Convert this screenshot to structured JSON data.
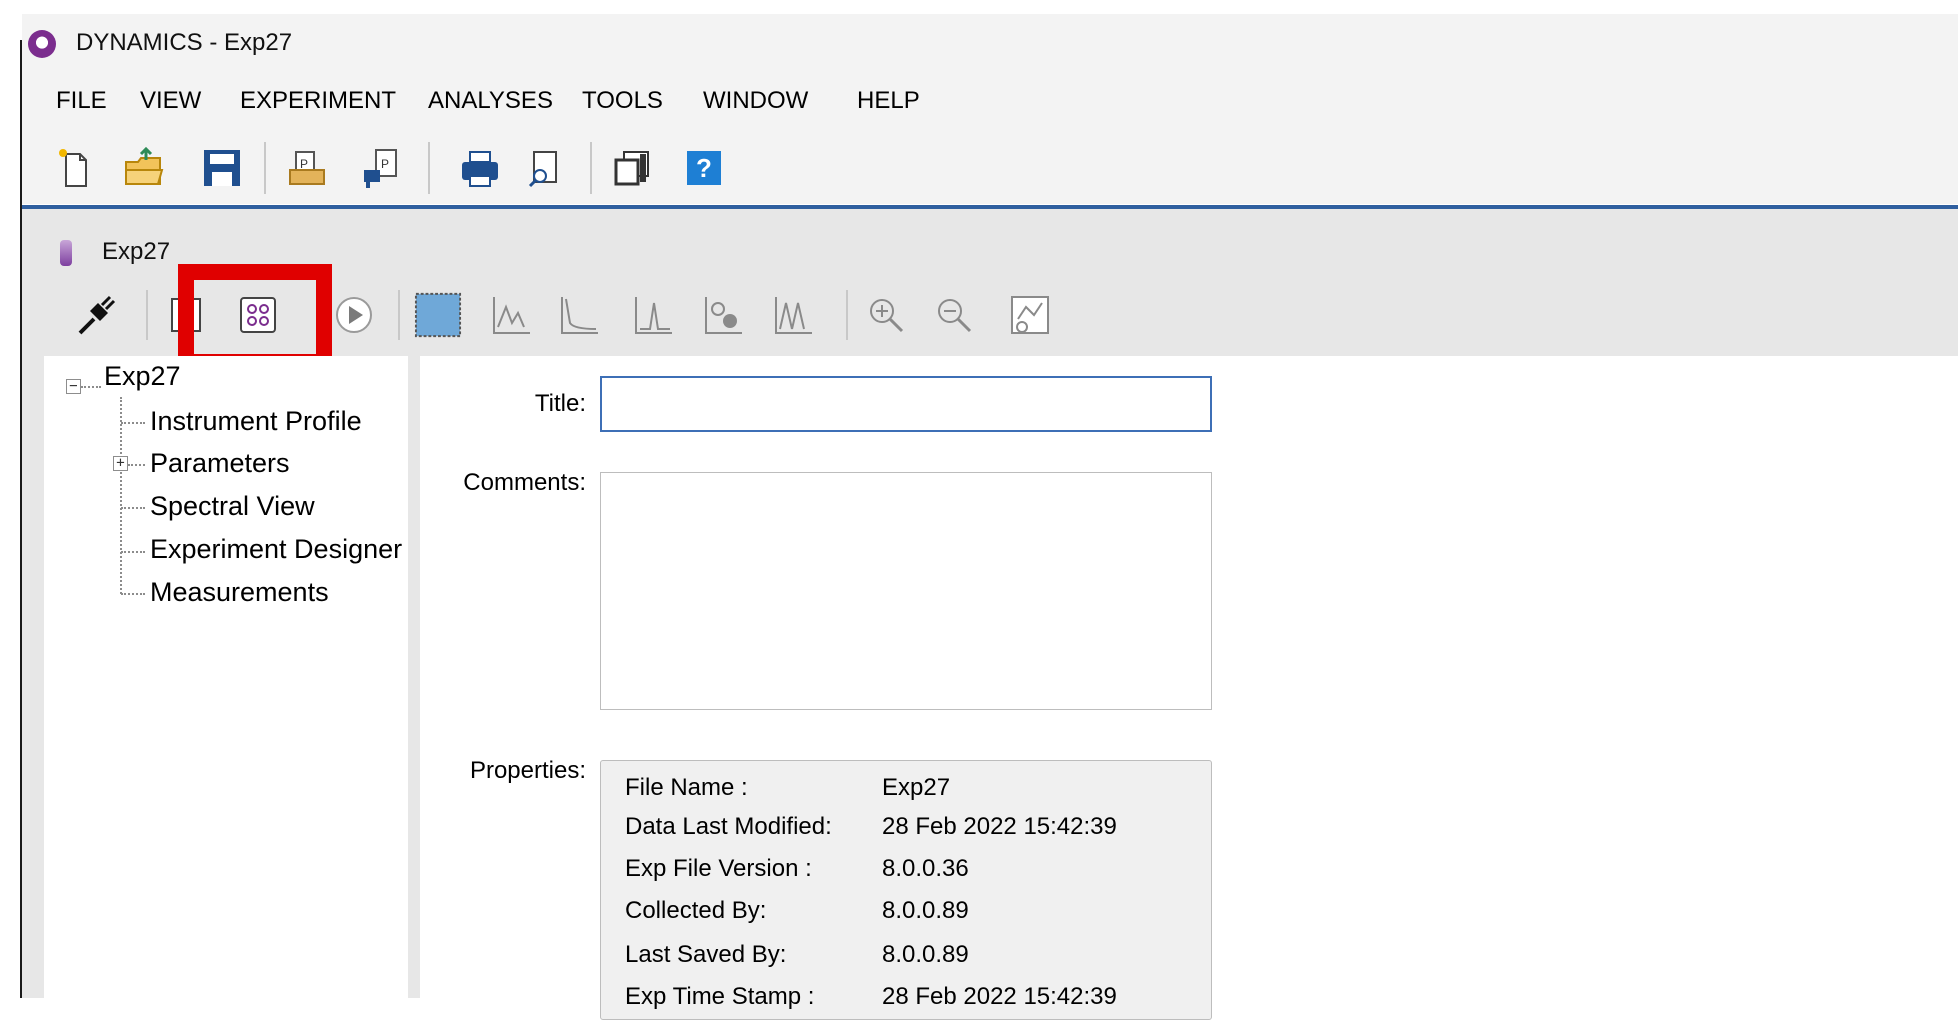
{
  "window": {
    "title": "DYNAMICS - Exp27"
  },
  "menu": [
    "FILE",
    "VIEW",
    "EXPERIMENT",
    "ANALYSES",
    "TOOLS",
    "WINDOW",
    "HELP"
  ],
  "toolbar": {
    "icons": [
      "new-file-icon",
      "open-folder-icon",
      "save-icon",
      "import-icon",
      "export-icon",
      "print-icon",
      "print-preview-icon",
      "window-layout-icon",
      "help-icon"
    ],
    "help_label": "?"
  },
  "child": {
    "title": "Exp27",
    "toolbar_icons": [
      "connect-plug-icon",
      "experiment-designer-icon",
      "plate-layout-icon",
      "run-icon",
      "grid-view-icon",
      "spectrum-icon",
      "decay-curve-icon",
      "peak-icon",
      "add-peak-icon",
      "overlay-icon",
      "zoom-in-icon",
      "zoom-out-icon",
      "zoom-settings-icon"
    ]
  },
  "tree": {
    "root": "Exp27",
    "items": [
      "Instrument Profile",
      "Parameters",
      "Spectral View",
      "Experiment Designer",
      "Measurements"
    ],
    "root_expander": "−",
    "parameters_expander": "+"
  },
  "form": {
    "title_label": "Title:",
    "title_value": "",
    "comments_label": "Comments:",
    "comments_value": "",
    "properties_label": "Properties:"
  },
  "properties": [
    {
      "key": "File Name :",
      "value": "Exp27"
    },
    {
      "key": "Data Last Modified:",
      "value": "28 Feb 2022 15:42:39"
    },
    {
      "key": "Exp File Version :",
      "value": "8.0.0.36"
    },
    {
      "key": "Collected By:",
      "value": "8.0.0.89"
    },
    {
      "key": "Last Saved By:",
      "value": "8.0.0.89"
    },
    {
      "key": "Exp Time Stamp :",
      "value": "28 Feb 2022 15:42:39"
    }
  ],
  "colors": {
    "highlight": "#e00000",
    "accent": "#2f5f9f",
    "brand": "#7b2d8e"
  }
}
